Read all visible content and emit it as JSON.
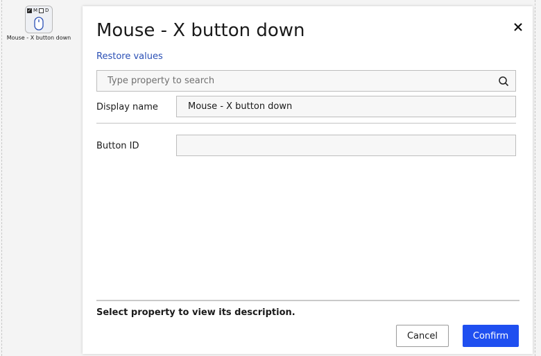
{
  "node": {
    "flag_m": "M",
    "flag_d": "D",
    "label": "Mouse - X button down",
    "icon": "mouse-icon"
  },
  "dialog": {
    "title": "Mouse - X button down",
    "close_icon": "close-icon",
    "restore_label": "Restore values",
    "search": {
      "placeholder": "Type property to search",
      "value": "",
      "icon": "search-icon"
    },
    "properties": [
      {
        "label": "Display name",
        "value": "Mouse - X button down"
      },
      {
        "label": "Button ID",
        "value": ""
      }
    ],
    "description": "Select property to view its description.",
    "cancel_label": "Cancel",
    "confirm_label": "Confirm"
  },
  "colors": {
    "accent": "#1f4ff0",
    "link": "#2a4fb5"
  }
}
